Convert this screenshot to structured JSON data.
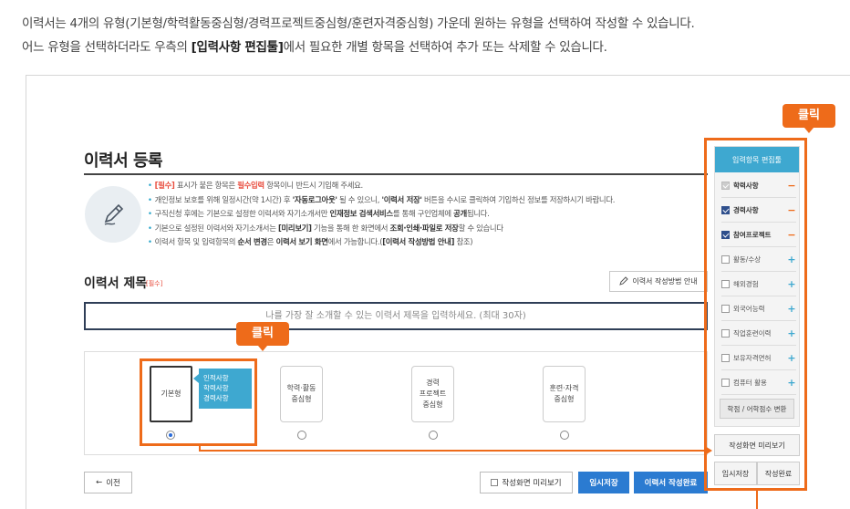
{
  "intro": {
    "line1": "이력서는 4개의 유형(기본형/학력활동중심형/경력프로젝트중심형/훈련자격중심형) 가운데 원하는 유형을 선택하여 작성할 수 있습니다.",
    "line2_pre": "어느 유형을 선택하더라도 우측의 ",
    "line2_bold": "[입력사항 편집툴]",
    "line2_post": "에서 필요한 개별 항목을 선택하여 추가 또는 삭제할 수 있습니다."
  },
  "page": {
    "title": "이력서 등록",
    "pen_icon": "pen-icon"
  },
  "notes": [
    {
      "a": "[필수]",
      "b": " 표시가 붙은 항목은 ",
      "c": "필수입력",
      "d": " 항목이니 반드시 기입해 주세요."
    },
    {
      "a": "개인정보 보호를 위해 일정시간(약 1시간) 후 ",
      "b": "'자동로그아웃'",
      "c": " 될 수 있으니, ",
      "d": "'이력서 저장'",
      "e": " 버튼을 수시로 클릭하여 기입하신 정보를 저장하시기 바랍니다."
    },
    {
      "a": "구직신청 후에는 기본으로 설정한 이력서와 자기소개서만 ",
      "b": "인재정보 검색서비스",
      "c": "를 통해 구인업체에 ",
      "d": "공개",
      "e": "됩니다."
    },
    {
      "a": "기본으로 설정된 이력서와 자기소개서는 ",
      "b": "[미리보기]",
      "c": " 기능을 통해 한 화면에서 ",
      "d": "조회·인쇄·파일로 저장",
      "e": "할 수 있습니다"
    },
    {
      "a": "이력서 항목 및 입력항목의 ",
      "b": "순서 변경",
      "c": "은 ",
      "d": "이력서 보기 화면",
      "e": "에서 가능합니다.(",
      "f": "[이력서 작성방법 안내]",
      "g": " 참조)"
    }
  ],
  "resume_title": {
    "label": "이력서 제목",
    "required": "[필수]",
    "guide_button": "이력서 작성방법 안내",
    "placeholder": "나를 가장 잘 소개할 수 있는 이력서 제목을 입력하세요. (최대 30자)"
  },
  "types": [
    {
      "label": "기본형",
      "selected": true
    },
    {
      "label": "학력·활동\n중심형",
      "selected": false
    },
    {
      "label": "경력\n프로젝트\n중심형",
      "selected": false
    },
    {
      "label": "훈련·자격\n중심형",
      "selected": false
    }
  ],
  "type_tip": {
    "l1": "인적사항",
    "l2": "학력사항",
    "l3": "경력사항"
  },
  "badges": {
    "click1": "클릭",
    "click2": "클릭"
  },
  "buttons": {
    "prev": "이전",
    "preview": "작성화면 미리보기",
    "temp_save": "임시저장",
    "complete": "이력서 작성완료"
  },
  "editor": {
    "header": "입력항목 편집툴",
    "items": [
      {
        "label": "학력사항",
        "state": "disabled",
        "action": "−"
      },
      {
        "label": "경력사항",
        "state": "on",
        "action": "−"
      },
      {
        "label": "참여프로젝트",
        "state": "on",
        "action": "−"
      },
      {
        "label": "활동/수상",
        "state": "off",
        "action": "+"
      },
      {
        "label": "해외경험",
        "state": "off",
        "action": "+"
      },
      {
        "label": "외국어능력",
        "state": "off",
        "action": "+"
      },
      {
        "label": "직업훈련이력",
        "state": "off",
        "action": "+"
      },
      {
        "label": "보유자격면허",
        "state": "off",
        "action": "+"
      },
      {
        "label": "컴퓨터 활용",
        "state": "off",
        "action": "+"
      }
    ],
    "convert": "학점 / 어학점수 변환",
    "preview": "작성화면 미리보기",
    "temp_save": "임시저장",
    "complete": "작성완료"
  },
  "colors": {
    "accent_orange": "#ee6b1a",
    "accent_blue": "#3ea8d0",
    "primary_btn": "#2b7bd1"
  }
}
